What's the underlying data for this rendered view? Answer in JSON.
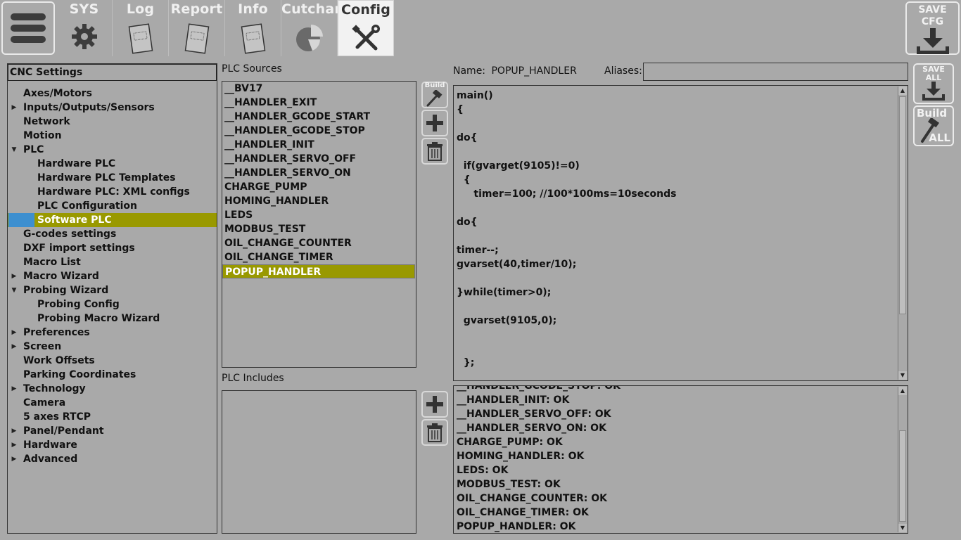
{
  "toolbar": {
    "tabs": [
      {
        "label": "SYS",
        "icon": "gear-icon"
      },
      {
        "label": "Log",
        "icon": "document-icon"
      },
      {
        "label": "Report",
        "icon": "document-icon"
      },
      {
        "label": "Info",
        "icon": "document-icon"
      },
      {
        "label": "Cutchart",
        "icon": "pie-chart-icon"
      },
      {
        "label": "Config",
        "icon": "tools-icon",
        "active": true
      }
    ],
    "save_cfg_line1": "SAVE",
    "save_cfg_line2": "CFG"
  },
  "side_buttons": {
    "save_all_line1": "SAVE",
    "save_all_line2": "ALL",
    "build_all_line1": "Build",
    "build_all_line2": "ALL"
  },
  "tree": {
    "header": "CNC Settings",
    "items": [
      {
        "label": "Axes/Motors",
        "level": 1,
        "arrow": ""
      },
      {
        "label": "Inputs/Outputs/Sensors",
        "level": 1,
        "arrow": "right"
      },
      {
        "label": "Network",
        "level": 1,
        "arrow": ""
      },
      {
        "label": "Motion",
        "level": 1,
        "arrow": ""
      },
      {
        "label": "PLC",
        "level": 1,
        "arrow": "down"
      },
      {
        "label": "Hardware PLC",
        "level": 2,
        "arrow": ""
      },
      {
        "label": "Hardware PLC Templates",
        "level": 2,
        "arrow": ""
      },
      {
        "label": "Hardware PLC: XML configs",
        "level": 2,
        "arrow": ""
      },
      {
        "label": "PLC Configuration",
        "level": 2,
        "arrow": ""
      },
      {
        "label": "Software PLC",
        "level": 2,
        "arrow": "",
        "selected": true
      },
      {
        "label": "G-codes settings",
        "level": 1,
        "arrow": ""
      },
      {
        "label": "DXF import settings",
        "level": 1,
        "arrow": ""
      },
      {
        "label": "Macro List",
        "level": 1,
        "arrow": ""
      },
      {
        "label": "Macro Wizard",
        "level": 1,
        "arrow": "right"
      },
      {
        "label": "Probing Wizard",
        "level": 1,
        "arrow": "down"
      },
      {
        "label": "Probing Config",
        "level": 2,
        "arrow": ""
      },
      {
        "label": "Probing Macro Wizard",
        "level": 2,
        "arrow": ""
      },
      {
        "label": "Preferences",
        "level": 1,
        "arrow": "right"
      },
      {
        "label": "Screen",
        "level": 1,
        "arrow": "right"
      },
      {
        "label": "Work Offsets",
        "level": 1,
        "arrow": ""
      },
      {
        "label": "Parking Coordinates",
        "level": 1,
        "arrow": ""
      },
      {
        "label": "Technology",
        "level": 1,
        "arrow": "right"
      },
      {
        "label": "Camera",
        "level": 1,
        "arrow": ""
      },
      {
        "label": "5 axes RTCP",
        "level": 1,
        "arrow": ""
      },
      {
        "label": "Panel/Pendant",
        "level": 1,
        "arrow": "right"
      },
      {
        "label": "Hardware",
        "level": 1,
        "arrow": "right"
      },
      {
        "label": "Advanced",
        "level": 1,
        "arrow": "right"
      }
    ]
  },
  "plc_sources": {
    "label": "PLC Sources",
    "items": [
      "__BV17",
      "__HANDLER_EXIT",
      "__HANDLER_GCODE_START",
      "__HANDLER_GCODE_STOP",
      "__HANDLER_INIT",
      "__HANDLER_SERVO_OFF",
      "__HANDLER_SERVO_ON",
      "CHARGE_PUMP",
      "HOMING_HANDLER",
      "LEDS",
      "MODBUS_TEST",
      "OIL_CHANGE_COUNTER",
      "OIL_CHANGE_TIMER",
      "POPUP_HANDLER"
    ],
    "selected_index": 13,
    "build_label": "Build"
  },
  "plc_includes": {
    "label": "PLC Includes",
    "items": []
  },
  "editor": {
    "name_label": "Name:",
    "name_value": "POPUP_HANDLER",
    "aliases_label": "Aliases:",
    "aliases_value": "",
    "code_lines": [
      "main()",
      "{",
      "",
      "do{",
      "",
      "  if(gvarget(9105)!=0)",
      "  {",
      "     timer=100; //100*100ms=10seconds",
      "",
      "do{",
      "",
      "timer--;",
      "gvarset(40,timer/10);",
      "",
      "}while(timer>0);",
      "",
      "  gvarset(9105,0);",
      "",
      "",
      "  };"
    ]
  },
  "output": {
    "partial_top_line": "__HANDLER_GCODE_STOP: OK",
    "lines": [
      "__HANDLER_INIT: OK",
      "__HANDLER_SERVO_OFF: OK",
      "__HANDLER_SERVO_ON: OK",
      "CHARGE_PUMP: OK",
      "HOMING_HANDLER: OK",
      "LEDS: OK",
      "MODBUS_TEST: OK",
      "OIL_CHANGE_COUNTER: OK",
      "OIL_CHANGE_TIMER: OK",
      "POPUP_HANDLER: OK"
    ]
  },
  "colors": {
    "background": "#a9a9a9",
    "selection": "#999900",
    "selection_marker": "#3d8fd0",
    "active_tab": "#f2f2f2"
  }
}
